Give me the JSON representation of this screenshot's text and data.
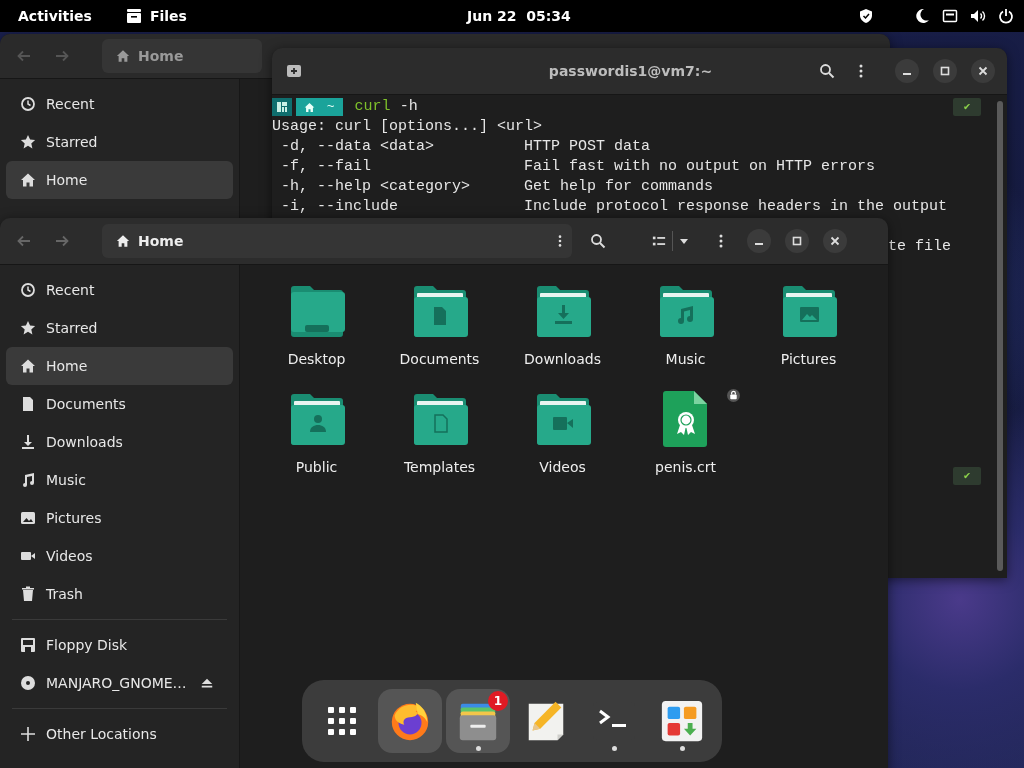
{
  "top_bar": {
    "activities": "Activities",
    "app_name": "Files",
    "clock": "Jun 22  05:34"
  },
  "back_window": {
    "path": "Home",
    "sidebar": [
      {
        "label": "Recent",
        "selected": false
      },
      {
        "label": "Starred",
        "selected": false
      },
      {
        "label": "Home",
        "selected": true
      }
    ]
  },
  "terminal": {
    "title": "passwordis1@vm7:~",
    "prompt_dir": "~",
    "program": "curl",
    "args": "-h",
    "lines": [
      "Usage: curl [options...] <url>",
      " -d, --data <data>          HTTP POST data",
      " -f, --fail                 Fail fast with no output on HTTP errors",
      " -h, --help <category>      Get help for commands",
      " -i, --include              Include protocol response headers in the output"
    ],
    "hidden_line_end": "te file",
    "status_marks": [
      "✔",
      "✔"
    ]
  },
  "files_window": {
    "path": "Home",
    "sidebar": [
      {
        "label": "Recent",
        "selected": false
      },
      {
        "label": "Starred",
        "selected": false
      },
      {
        "label": "Home",
        "selected": true
      },
      {
        "label": "Documents",
        "selected": false
      },
      {
        "label": "Downloads",
        "selected": false
      },
      {
        "label": "Music",
        "selected": false
      },
      {
        "label": "Pictures",
        "selected": false
      },
      {
        "label": "Videos",
        "selected": false
      },
      {
        "label": "Trash",
        "selected": false
      }
    ],
    "devices": [
      {
        "label": "Floppy Disk",
        "ejectable": false
      },
      {
        "label": "MANJARO_GNOME…",
        "ejectable": true
      }
    ],
    "other_locations": "Other Locations",
    "items": [
      {
        "name": "Desktop",
        "kind": "folder",
        "locked": false
      },
      {
        "name": "Documents",
        "kind": "folder",
        "locked": false
      },
      {
        "name": "Downloads",
        "kind": "folder",
        "locked": false
      },
      {
        "name": "Music",
        "kind": "folder",
        "locked": false
      },
      {
        "name": "Pictures",
        "kind": "folder",
        "locked": false
      },
      {
        "name": "Public",
        "kind": "folder",
        "locked": false
      },
      {
        "name": "Templates",
        "kind": "folder",
        "locked": false
      },
      {
        "name": "Videos",
        "kind": "folder",
        "locked": false
      },
      {
        "name": "penis.crt",
        "kind": "certificate",
        "locked": true
      }
    ]
  },
  "dock": [
    {
      "kind": "app-grid",
      "highlighted": false,
      "running": false
    },
    {
      "kind": "app",
      "highlighted": true,
      "running": false
    },
    {
      "kind": "app",
      "highlighted": true,
      "running": true,
      "badge": "1"
    },
    {
      "kind": "app",
      "highlighted": false,
      "running": false
    },
    {
      "kind": "app",
      "highlighted": false,
      "running": true
    },
    {
      "kind": "app",
      "highlighted": false,
      "running": true
    }
  ]
}
